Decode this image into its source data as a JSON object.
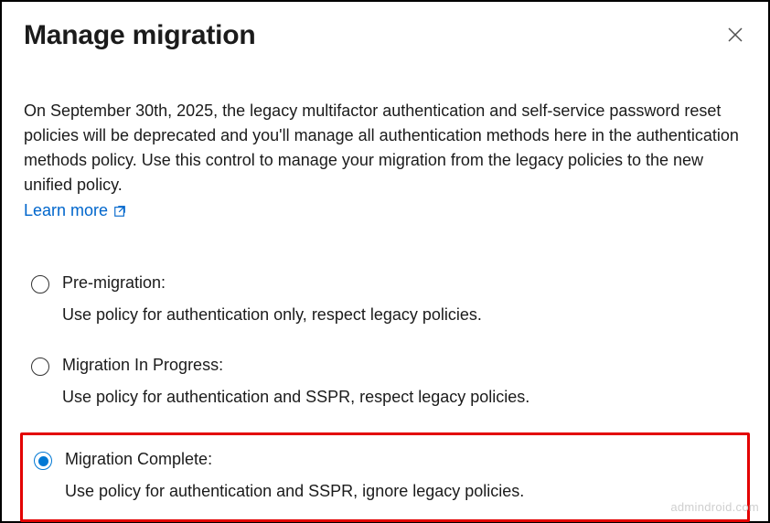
{
  "header": {
    "title": "Manage migration"
  },
  "description": "On September 30th, 2025, the legacy multifactor authentication and self-service password reset policies will be deprecated and you'll manage all authentication methods here in the authentication methods policy. Use this control to manage your migration from the legacy policies to the new unified policy.",
  "learnMore": "Learn more",
  "options": [
    {
      "title": "Pre-migration:",
      "description": "Use policy for authentication only, respect legacy policies.",
      "selected": false,
      "highlighted": false
    },
    {
      "title": "Migration In Progress:",
      "description": "Use policy for authentication and SSPR, respect legacy policies.",
      "selected": false,
      "highlighted": false
    },
    {
      "title": "Migration Complete:",
      "description": "Use policy for authentication and SSPR, ignore legacy policies.",
      "selected": true,
      "highlighted": true
    }
  ],
  "watermark": "admindroid.com"
}
